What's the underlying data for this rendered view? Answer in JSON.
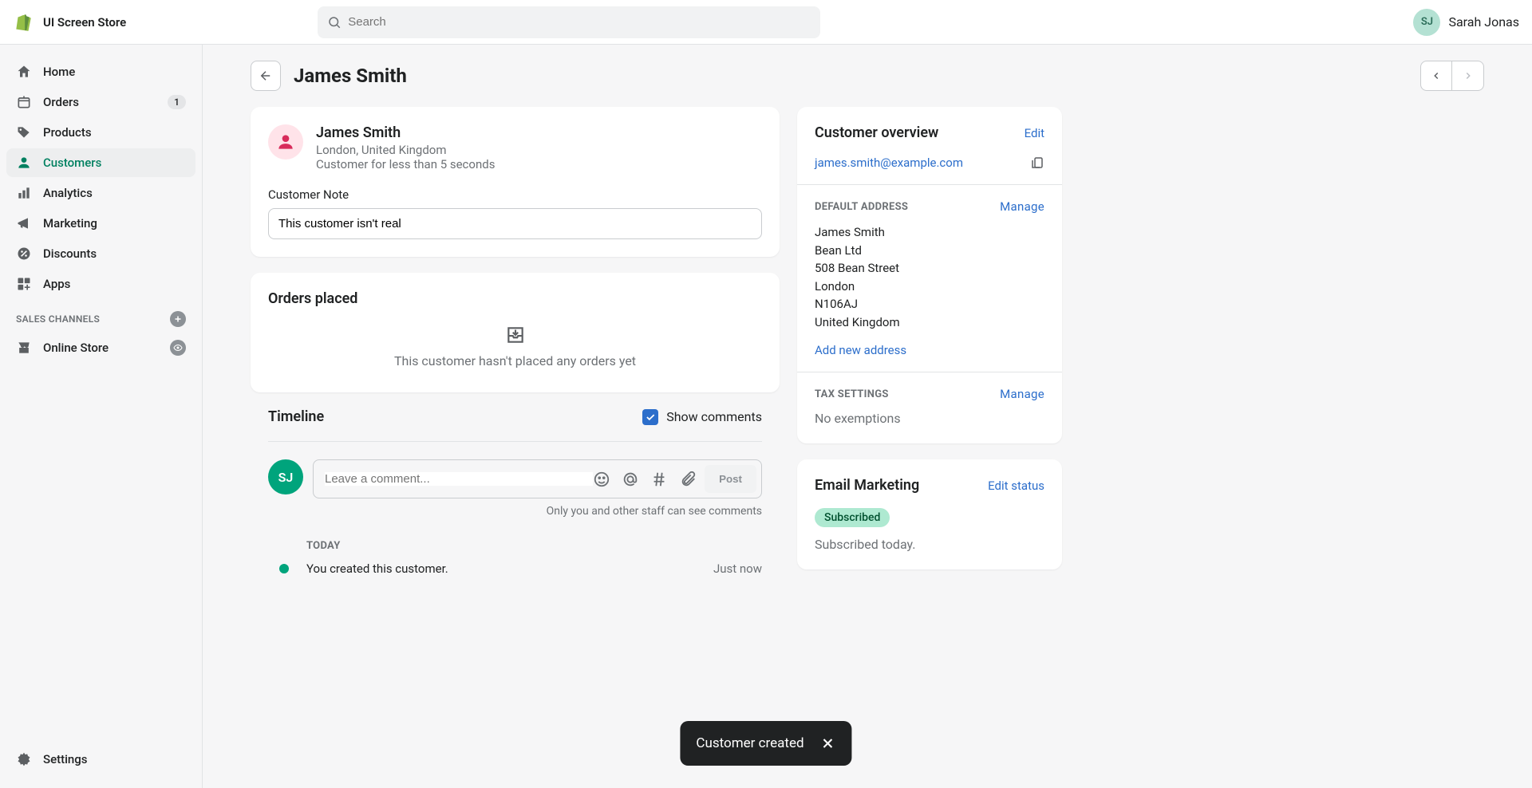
{
  "topbar": {
    "store_name": "UI Screen Store",
    "search_placeholder": "Search",
    "user_initials": "SJ",
    "user_name": "Sarah Jonas"
  },
  "sidebar": {
    "items": [
      {
        "label": "Home"
      },
      {
        "label": "Orders",
        "badge": "1"
      },
      {
        "label": "Products"
      },
      {
        "label": "Customers"
      },
      {
        "label": "Analytics"
      },
      {
        "label": "Marketing"
      },
      {
        "label": "Discounts"
      },
      {
        "label": "Apps"
      }
    ],
    "section_label": "SALES CHANNELS",
    "channels": [
      {
        "label": "Online Store"
      }
    ],
    "settings_label": "Settings"
  },
  "page": {
    "title": "James Smith"
  },
  "customer": {
    "name": "James Smith",
    "location": "London, United Kingdom",
    "duration": "Customer for less than 5 seconds",
    "note_label": "Customer Note",
    "note_value": "This customer isn't real"
  },
  "orders": {
    "title": "Orders placed",
    "empty_text": "This customer hasn't placed any orders yet"
  },
  "timeline": {
    "title": "Timeline",
    "show_comments_label": "Show comments",
    "comment_placeholder": "Leave a comment...",
    "post_label": "Post",
    "hint": "Only you and other staff can see comments",
    "today_label": "TODAY",
    "event_text": "You created this customer.",
    "event_time": "Just now",
    "avatar_initials": "SJ"
  },
  "overview": {
    "title": "Customer overview",
    "edit_label": "Edit",
    "email": "james.smith@example.com",
    "address_label": "DEFAULT ADDRESS",
    "manage_label": "Manage",
    "address": {
      "name": "James Smith",
      "company": "Bean Ltd",
      "street": "508 Bean Street",
      "city": "London",
      "postal": "N106AJ",
      "country": "United Kingdom"
    },
    "add_address_label": "Add new address",
    "tax_label": "TAX SETTINGS",
    "tax_text": "No exemptions"
  },
  "email_marketing": {
    "title": "Email Marketing",
    "edit_label": "Edit status",
    "status": "Subscribed",
    "detail": "Subscribed today."
  },
  "toast": {
    "message": "Customer created"
  }
}
